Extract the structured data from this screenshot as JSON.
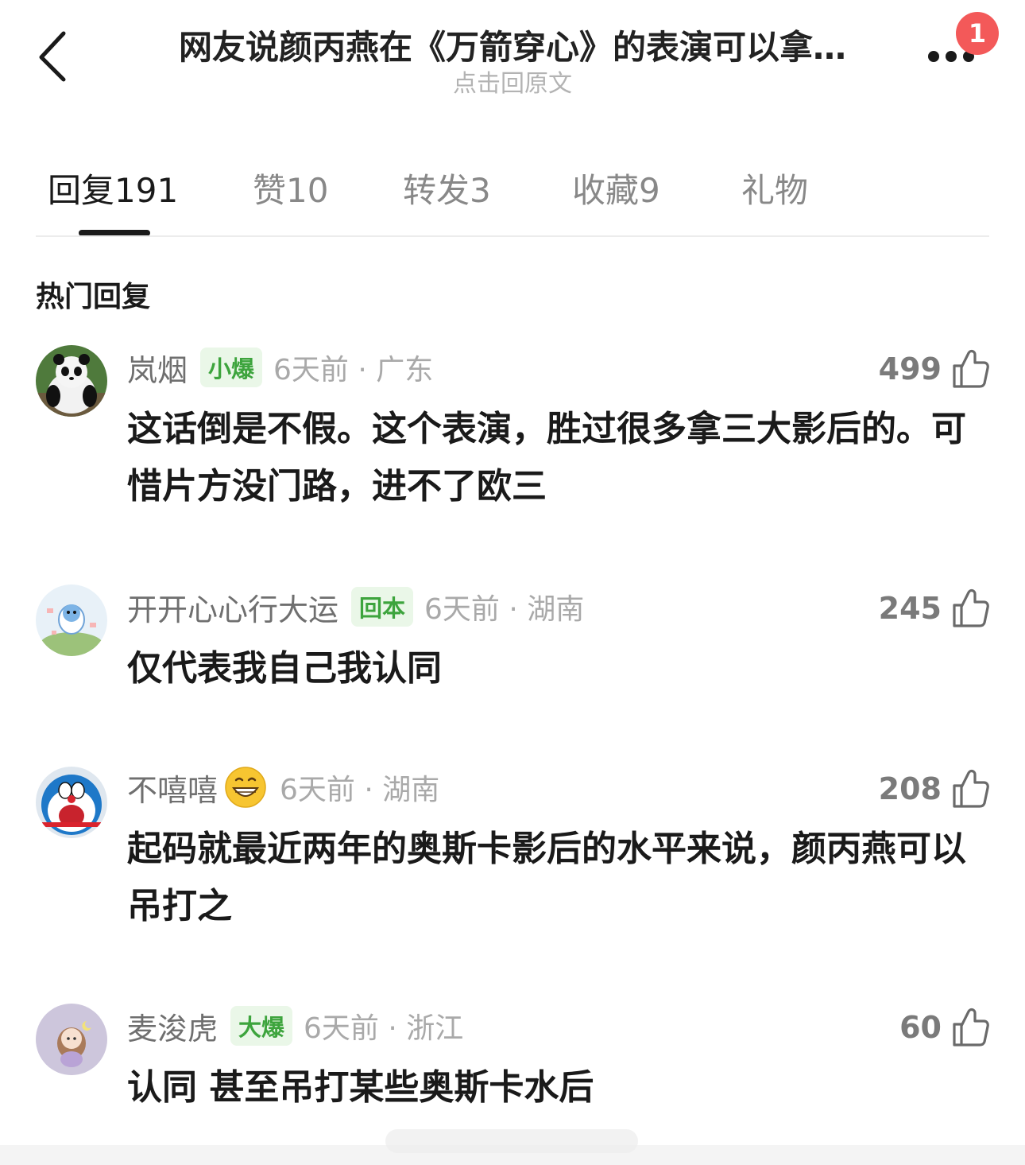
{
  "header": {
    "title": "网友说颜丙燕在《万箭穿心》的表演可以拿…",
    "subtitle": "点击回原文",
    "notification_count": "1"
  },
  "tabs": [
    {
      "label": "回复",
      "count": "191",
      "active": true
    },
    {
      "label": "赞",
      "count": "10",
      "active": false
    },
    {
      "label": "转发",
      "count": "3",
      "active": false
    },
    {
      "label": "收藏",
      "count": "9",
      "active": false
    },
    {
      "label": "礼物",
      "count": "",
      "active": false
    }
  ],
  "section_title": "热门回复",
  "comments": [
    {
      "username": "岚烟",
      "badge": "小爆",
      "time_location": "6天前 · 广东",
      "likes": "499",
      "text": "这话倒是不假。这个表演，胜过很多拿三大影后的。可惜片方没门路，进不了欧三",
      "avatar": "panda-avatar"
    },
    {
      "username": "开开心心行大运",
      "badge": "回本",
      "time_location": "6天前 · 湖南",
      "likes": "245",
      "text": "仅代表我自己我认同",
      "avatar": "cartoon-avatar"
    },
    {
      "username": "不嘻嘻",
      "badge": "",
      "emoji": "grinning-emoji",
      "time_location": "6天前 · 湖南",
      "likes": "208",
      "text": "起码就最近两年的奥斯卡影后的水平来说，颜丙燕可以吊打之",
      "avatar": "doraemon-avatar"
    },
    {
      "username": "麦浚虎",
      "badge": "大爆",
      "time_location": "6天前 · 浙江",
      "likes": "60",
      "text": "认同 甚至吊打某些奥斯卡水后",
      "avatar": "anime-avatar"
    }
  ],
  "colors": {
    "badge_green": "#3da43d",
    "badge_bg": "#eaf7e8",
    "notif_red": "#f35959"
  }
}
